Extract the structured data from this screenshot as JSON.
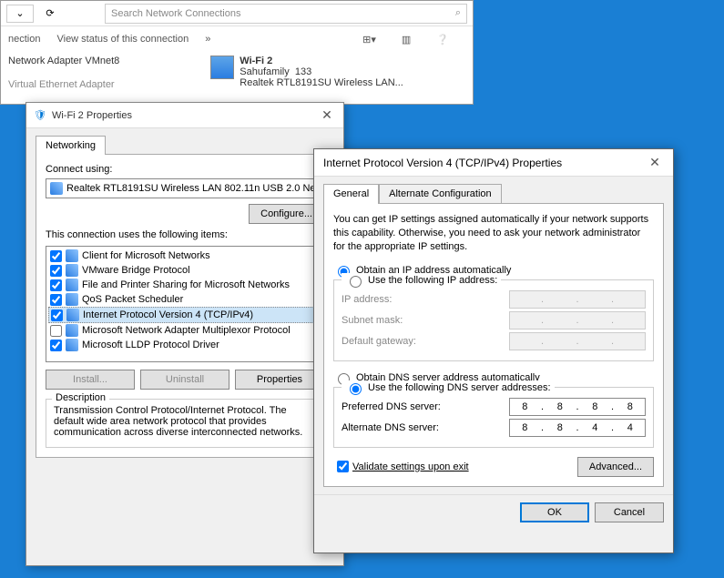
{
  "bg": {
    "search_placeholder": "Search Network Connections",
    "nection": "nection",
    "view_status": "View status of this connection",
    "adapter_label": "Network Adapter VMnet8",
    "virtual_label": "Virtual Ethernet Adapter",
    "wifi": {
      "name": "Wi-Fi 2",
      "ssid": "Sahufamily",
      "signal": "133",
      "device": "Realtek RTL8191SU Wireless LAN..."
    }
  },
  "dlg1": {
    "title": "Wi-Fi 2 Properties",
    "tab": "Networking",
    "connect_using_label": "Connect using:",
    "adapter": "Realtek RTL8191SU Wireless LAN 802.11n USB 2.0 Ne",
    "configure_btn": "Configure...",
    "items_label": "This connection uses the following items:",
    "items": [
      {
        "checked": true,
        "label": "Client for Microsoft Networks"
      },
      {
        "checked": true,
        "label": "VMware Bridge Protocol"
      },
      {
        "checked": true,
        "label": "File and Printer Sharing for Microsoft Networks"
      },
      {
        "checked": true,
        "label": "QoS Packet Scheduler"
      },
      {
        "checked": true,
        "label": "Internet Protocol Version 4 (TCP/IPv4)",
        "selected": true
      },
      {
        "checked": false,
        "label": "Microsoft Network Adapter Multiplexor Protocol"
      },
      {
        "checked": true,
        "label": "Microsoft LLDP Protocol Driver"
      }
    ],
    "install_btn": "Install...",
    "uninstall_btn": "Uninstall",
    "properties_btn": "Properties",
    "desc_label": "Description",
    "desc_text": "Transmission Control Protocol/Internet Protocol. The default wide area network protocol that provides communication across diverse interconnected networks."
  },
  "dlg2": {
    "title": "Internet Protocol Version 4 (TCP/IPv4) Properties",
    "tabs": [
      "General",
      "Alternate Configuration"
    ],
    "info": "You can get IP settings assigned automatically if your network supports this capability. Otherwise, you need to ask your network administrator for the appropriate IP settings.",
    "ip_auto": "Obtain an IP address automatically",
    "ip_manual": "Use the following IP address:",
    "ip_fields": {
      "ip": "IP address:",
      "mask": "Subnet mask:",
      "gw": "Default gateway:"
    },
    "dns_auto": "Obtain DNS server address automatically",
    "dns_manual": "Use the following DNS server addresses:",
    "dns_pref_label": "Preferred DNS server:",
    "dns_alt_label": "Alternate DNS server:",
    "dns_pref": [
      "8",
      "8",
      "8",
      "8"
    ],
    "dns_alt": [
      "8",
      "8",
      "4",
      "4"
    ],
    "validate": "Validate settings upon exit",
    "advanced_btn": "Advanced...",
    "ok": "OK",
    "cancel": "Cancel"
  }
}
